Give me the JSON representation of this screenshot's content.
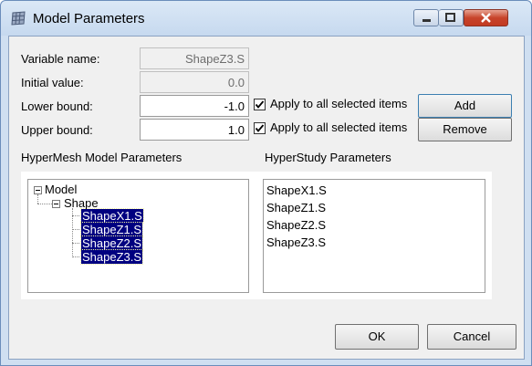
{
  "window": {
    "title": "Model Parameters"
  },
  "form": {
    "variable_name_label": "Variable name:",
    "variable_name_value": "ShapeZ3.S",
    "initial_value_label": "Initial value:",
    "initial_value_value": "0.0",
    "lower_bound_label": "Lower bound:",
    "lower_bound_value": "-1.0",
    "upper_bound_label": "Upper bound:",
    "upper_bound_value": "1.0",
    "apply_lower_label": "Apply to all selected items",
    "apply_upper_label": "Apply to all selected items",
    "apply_lower_checked": true,
    "apply_upper_checked": true
  },
  "buttons": {
    "add": "Add",
    "remove": "Remove",
    "ok": "OK",
    "cancel": "Cancel"
  },
  "hypermesh": {
    "title": "HyperMesh Model Parameters",
    "tree": {
      "root": "Model",
      "group": "Shape",
      "items": [
        "ShapeX1.S",
        "ShapeZ1.S",
        "ShapeZ2.S",
        "ShapeZ3.S"
      ]
    }
  },
  "hyperstudy": {
    "title": "HyperStudy Parameters",
    "items": [
      "ShapeX1.S",
      "ShapeZ1.S",
      "ShapeZ2.S",
      "ShapeZ3.S"
    ]
  },
  "colors": {
    "selection": "#000080",
    "title_bar": "#c6d9ef",
    "close_button": "#c7442b"
  }
}
